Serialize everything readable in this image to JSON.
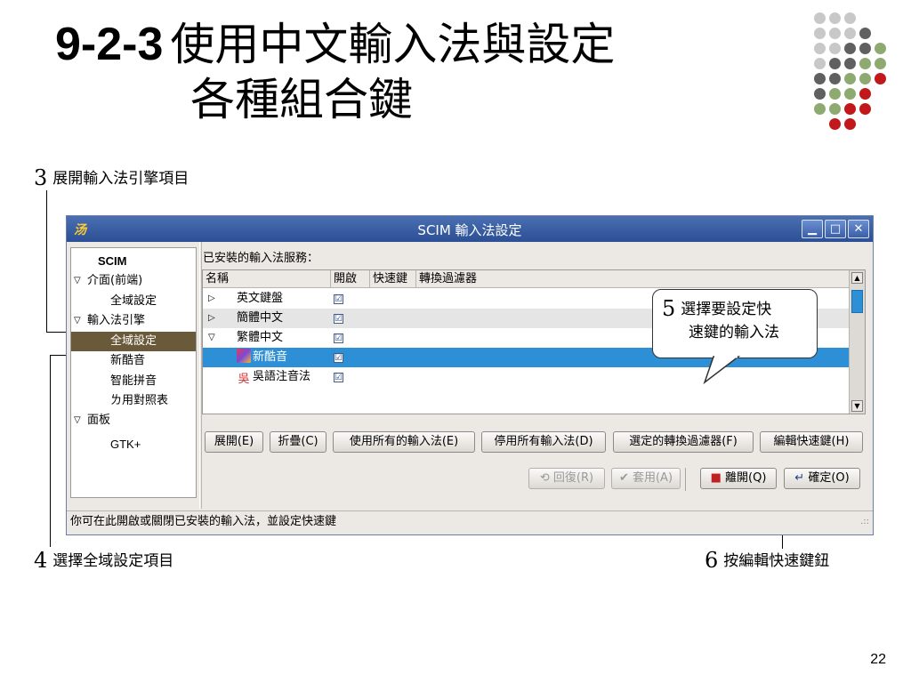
{
  "slide": {
    "title_num": "9-2-3",
    "title_line1": "使用中文輸入法與設定",
    "title_line2": "各種組合鍵",
    "page_number": "22",
    "dot_colors": {
      "grey_light": "#c8c8c8",
      "grey_dark": "#606060",
      "green": "#8faa70",
      "red": "#c0181b"
    }
  },
  "callouts": {
    "c3": {
      "num": "3",
      "text": "展開輸入法引擎項目"
    },
    "c4": {
      "num": "4",
      "text": "選擇全域設定項目"
    },
    "c5": {
      "num": "5",
      "text_line1": "選擇要設定快",
      "text_line2": "速鍵的輸入法"
    },
    "c6": {
      "num": "6",
      "text": "按編輯快速鍵鈕"
    }
  },
  "window": {
    "title": "SCIM 輸入法設定",
    "icon_label": "汤",
    "controls": {
      "minimize": "▁",
      "maximize": "□",
      "close": "✕"
    }
  },
  "sidebar": {
    "items": [
      {
        "label": "SCIM",
        "expanded_marker": ""
      },
      {
        "label": "介面(前端)",
        "expanded_marker": "▽"
      },
      {
        "label": "全域設定",
        "expanded_marker": ""
      },
      {
        "label": "輸入法引擎",
        "expanded_marker": "▽"
      },
      {
        "label": "全域設定",
        "expanded_marker": ""
      },
      {
        "label": "新酷音",
        "expanded_marker": ""
      },
      {
        "label": "智能拼音",
        "expanded_marker": ""
      },
      {
        "label": "ㄌ用對照表",
        "expanded_marker": ""
      },
      {
        "label": "面板",
        "expanded_marker": "▽"
      },
      {
        "label": "GTK+",
        "expanded_marker": ""
      }
    ]
  },
  "main": {
    "section_label": "已安裝的輸入法服務：",
    "columns": [
      "名稱",
      "開啟",
      "快速鍵",
      "轉換過濾器"
    ],
    "rows": [
      {
        "toggle": "▷",
        "name": "英文鍵盤",
        "checked": "☑"
      },
      {
        "toggle": "▷",
        "name": "簡體中文",
        "checked": "☑"
      },
      {
        "toggle": "▽",
        "name": "繁體中文",
        "checked": "☑"
      },
      {
        "toggle": "",
        "name": "新酷音",
        "checked": "☑"
      },
      {
        "toggle": "",
        "name": "吳語注音法",
        "checked": "☑"
      }
    ],
    "row_colors": {
      "selected": "#2d8fd6",
      "alt": "#e5e5e5"
    },
    "scroll_up": "▲",
    "scroll_down": "▼"
  },
  "buttons": {
    "expand": "展開(E)",
    "collapse": "折疊(C)",
    "enable_all": "使用所有的輸入法(E)",
    "disable_all": "停用所有輸入法(D)",
    "filters": "選定的轉換過濾器(F)",
    "edit_hotkeys": "編輯快速鍵(H)",
    "revert": "回復(R)",
    "apply": "套用(A)",
    "close": "離開(Q)",
    "ok": "確定(O)"
  },
  "statusbar": {
    "text": "你可在此開啟或關閉已安裝的輸入法，並設定快速鍵",
    "grip": ".::"
  }
}
